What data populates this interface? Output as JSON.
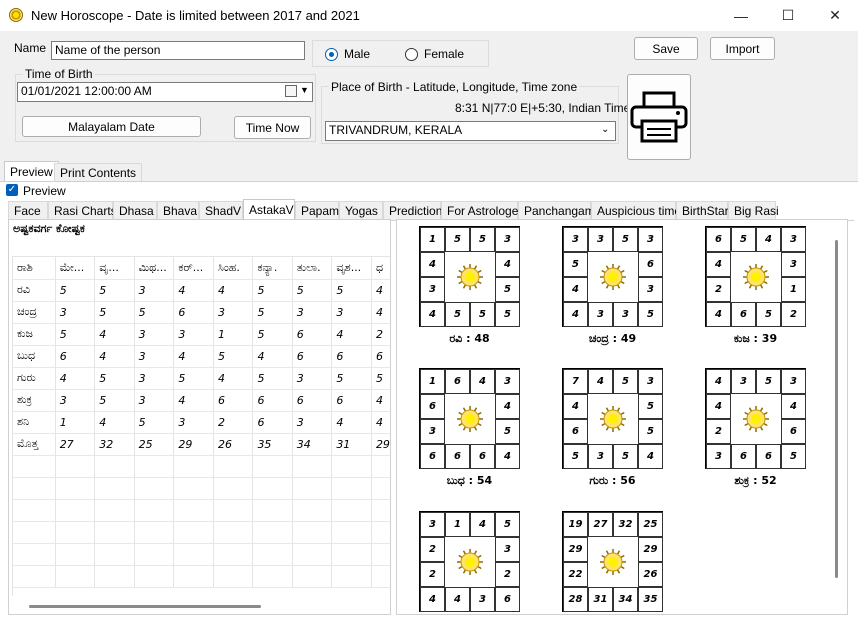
{
  "window": {
    "title": "New Horoscope - Date is limited between 2017 and 2021",
    "minimize": "—",
    "maximize": "☐",
    "close": "✕"
  },
  "form": {
    "name_label": "Name",
    "name_value": "Name of the person",
    "gender_male": "Male",
    "gender_female": "Female",
    "save_label": "Save",
    "import_label": "Import",
    "time_of_birth_label": "Time of Birth",
    "datetime_value": "01/01/2021  12:00:00 AM",
    "malayalam_date_label": "Malayalam Date",
    "time_now_label": "Time Now",
    "place_label": "Place of Birth - Latitude, Longitude, Time zone",
    "coords_value": "8:31 N|77:0 E|+5:30, Indian Time",
    "place_value": "TRIVANDRUM, KERALA"
  },
  "outer_tabs": [
    "Preview",
    "Print Contents"
  ],
  "preview_checkbox_label": "Preview",
  "inner_tabs": [
    "Face",
    "Rasi Charts",
    "Dhasa",
    "Bhava",
    "ShadV",
    "AstakaV",
    "Papam",
    "Yogas",
    "Prediction",
    "For Astrologer",
    "Panchangam",
    "Auspicious time",
    "BirthStar",
    "Big Rasi"
  ],
  "table_title": "ಅಷ್ಟಕವರ್ಗ ಕೋಷ್ಟಕ",
  "table": {
    "headers": [
      "ರಾಶಿ",
      "ಮೇ...",
      "ವೃ...",
      "ಮಿಥ...",
      "ಕರ್...",
      "ಸಿಂಹ.",
      "ಕನ್ಯಾ.",
      "ತುಲಾ.",
      "ವೃಶ...",
      "ಧ"
    ],
    "rows": [
      [
        "ರವಿ",
        "5",
        "5",
        "3",
        "4",
        "4",
        "5",
        "5",
        "5",
        "4"
      ],
      [
        "ಚಂದ್ರ",
        "3",
        "5",
        "5",
        "6",
        "3",
        "5",
        "3",
        "3",
        "4"
      ],
      [
        "ಕುಜ",
        "5",
        "4",
        "3",
        "3",
        "1",
        "5",
        "6",
        "4",
        "2"
      ],
      [
        "ಬುಧ",
        "6",
        "4",
        "3",
        "4",
        "5",
        "4",
        "6",
        "6",
        "6"
      ],
      [
        "ಗುರು",
        "4",
        "5",
        "3",
        "5",
        "4",
        "5",
        "3",
        "5",
        "5"
      ],
      [
        "ಶುಕ್ರ",
        "3",
        "5",
        "3",
        "4",
        "6",
        "6",
        "6",
        "6",
        "4"
      ],
      [
        "ಶನಿ",
        "1",
        "4",
        "5",
        "3",
        "2",
        "6",
        "3",
        "4",
        "4"
      ],
      [
        "ಮೊತ್ತ",
        "27",
        "32",
        "25",
        "29",
        "26",
        "35",
        "34",
        "31",
        "29"
      ]
    ]
  },
  "charts": [
    {
      "label": "ರವಿ : 48",
      "cells": [
        "1",
        "5",
        "5",
        "3",
        "4",
        "4",
        "3",
        "5",
        "4",
        "5",
        "5",
        "5"
      ]
    },
    {
      "label": "ಚಂದ್ರ : 49",
      "cells": [
        "3",
        "3",
        "5",
        "3",
        "5",
        "6",
        "4",
        "3",
        "4",
        "3",
        "3",
        "5"
      ]
    },
    {
      "label": "ಕುಜ : 39",
      "cells": [
        "6",
        "5",
        "4",
        "3",
        "4",
        "3",
        "2",
        "1",
        "4",
        "6",
        "5",
        "2"
      ]
    },
    {
      "label": "ಬುಧ : 54",
      "cells": [
        "1",
        "6",
        "4",
        "3",
        "6",
        "4",
        "3",
        "5",
        "6",
        "6",
        "6",
        "4"
      ]
    },
    {
      "label": "ಗುರು : 56",
      "cells": [
        "7",
        "4",
        "5",
        "3",
        "4",
        "5",
        "6",
        "5",
        "5",
        "3",
        "5",
        "4"
      ]
    },
    {
      "label": "ಶುಕ್ರ : 52",
      "cells": [
        "4",
        "3",
        "5",
        "3",
        "4",
        "4",
        "2",
        "6",
        "3",
        "6",
        "6",
        "5"
      ]
    },
    {
      "label": "",
      "cells": [
        "3",
        "1",
        "4",
        "5",
        "2",
        "3",
        "2",
        "2",
        "4",
        "4",
        "3",
        "6"
      ]
    },
    {
      "label": "",
      "cells": [
        "19",
        "27",
        "32",
        "25",
        "29",
        "29",
        "22",
        "26",
        "28",
        "31",
        "34",
        "35"
      ]
    }
  ]
}
